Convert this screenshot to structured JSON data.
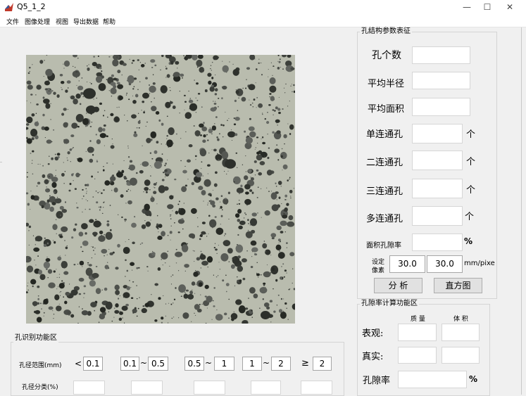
{
  "window": {
    "title": "Q5_1_2",
    "minimize": "—",
    "maximize": "☐",
    "close": "✕"
  },
  "menu": [
    "文件",
    "图像处理",
    "视图",
    "导出数据",
    "帮助"
  ],
  "pore_params": {
    "title": "孔结构参数表征",
    "pore_count": "孔个数",
    "avg_radius": "平均半径",
    "avg_area": "平均面积",
    "single": "单连通孔",
    "double": "二连通孔",
    "triple": "三连通孔",
    "multi": "多连通孔",
    "unit_count": "个",
    "area_porosity": "面积孔隙率",
    "unit_percent": "%",
    "set_pixel_1": "设定",
    "set_pixel_2": "像素",
    "pixel_x": "30.0",
    "pixel_y": "30.0",
    "pixel_unit": "mm/pixe",
    "analyze_btn": "分 析",
    "histogram_btn": "直方图"
  },
  "porosity_calc": {
    "title": "孔隙率计算功能区",
    "col_mass": "质 量",
    "col_volume": "体 积",
    "apparent": "表观:",
    "true": "真实:",
    "porosity": "孔隙率",
    "unit_percent": "%"
  },
  "pore_recognition": {
    "title": "孔识别功能区",
    "range_label": "孔径范围(mm)",
    "class_label": "孔径分类(%)",
    "r1_sym": "<",
    "r1_val": "0.1",
    "r2_min": "0.1",
    "r2_max": "0.5",
    "r3_min": "0.5",
    "r3_max": "1",
    "r4_min": "1",
    "r4_max": "2",
    "r5_sym": "≥",
    "r5_val": "2",
    "tilde": "~"
  },
  "colors": {
    "window_bg": "#f0f0f0",
    "panel_border": "#d4d4d4",
    "photo_base": "#b9bcae",
    "pore_dark": "#2d302b"
  }
}
